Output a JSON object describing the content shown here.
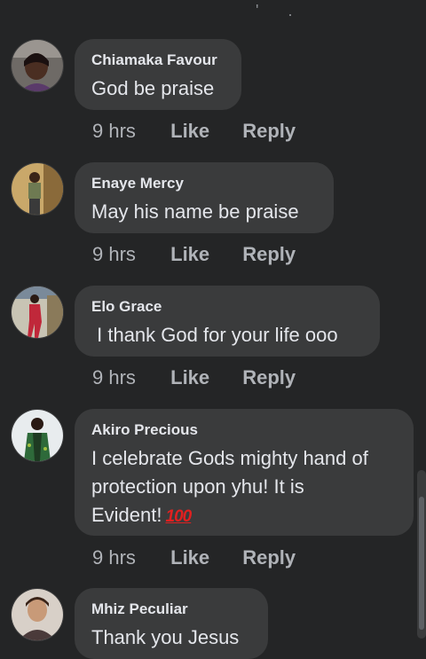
{
  "top_fragment": "' .",
  "comments": [
    {
      "author": "Chiamaka Favour",
      "text": "God be praise",
      "time": "9 hrs",
      "like": "Like",
      "reply": "Reply"
    },
    {
      "author": "Enaye Mercy",
      "text": "May his name be praise",
      "time": "9 hrs",
      "like": "Like",
      "reply": "Reply"
    },
    {
      "author": "Elo Grace",
      "text": " I thank God for your life ooo",
      "time": "9 hrs",
      "like": "Like",
      "reply": "Reply"
    },
    {
      "author": "Akiro Precious",
      "text": "I celebrate Gods mighty hand of\nprotection upon yhu! It is\nEvident!",
      "emoji": "100",
      "time": "9 hrs",
      "like": "Like",
      "reply": "Reply"
    },
    {
      "author": "Mhiz Peculiar",
      "text": "Thank you Jesus"
    }
  ],
  "colors": {
    "background": "#242526",
    "bubble": "#3a3b3c",
    "text": "#e4e6eb",
    "meta": "#b0b3b8",
    "emoji_red": "#e02020"
  },
  "icons": {
    "emoji": "hundred-points-emoji-icon"
  }
}
